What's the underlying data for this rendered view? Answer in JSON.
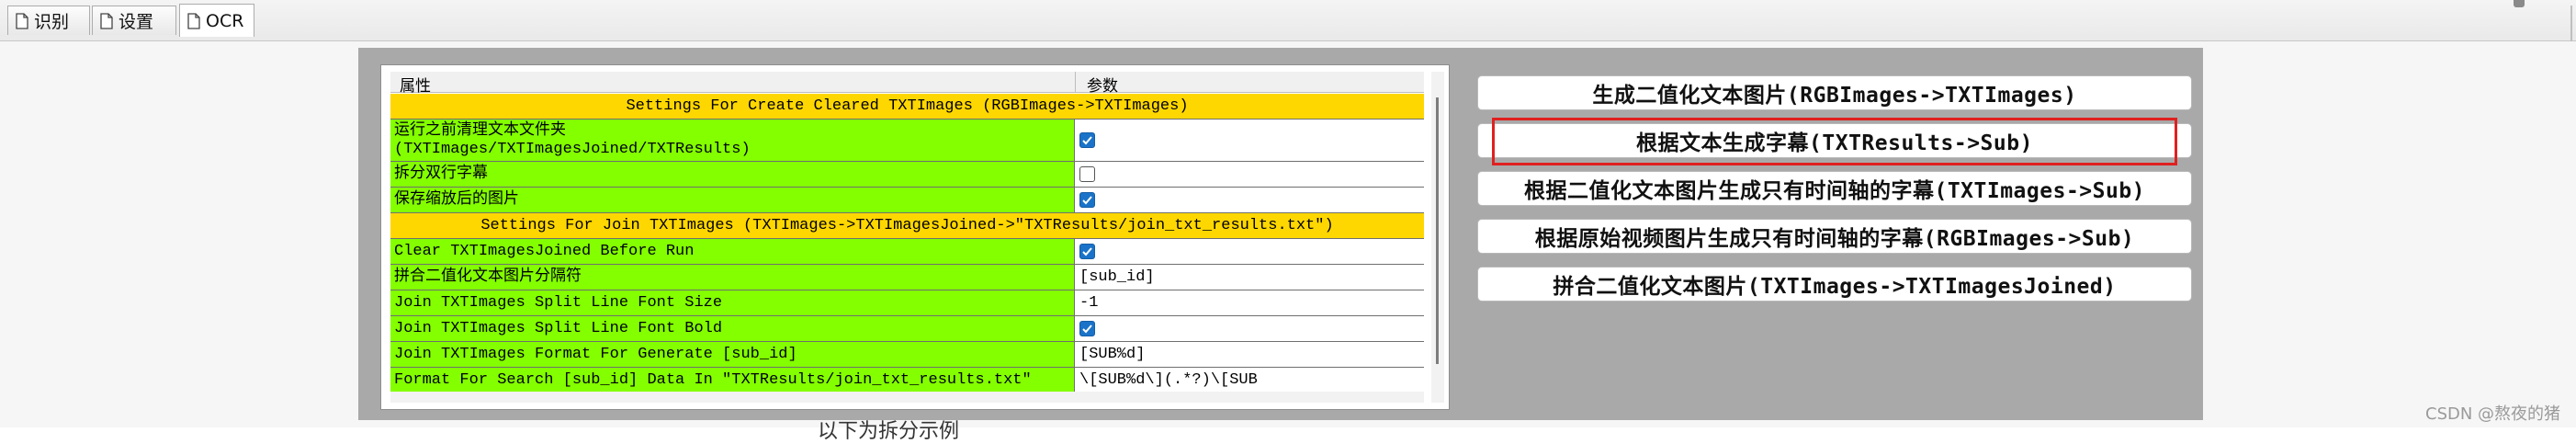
{
  "tabs": [
    {
      "label": "识别",
      "icon": "document-icon"
    },
    {
      "label": "设置",
      "icon": "document-icon"
    },
    {
      "label": "OCR",
      "icon": "document-icon"
    }
  ],
  "grid": {
    "headers": {
      "property": "属性",
      "value": "参数"
    },
    "sections": [
      {
        "title": "Settings For Create Cleared TXTImages (RGBImages->TXTImages)"
      },
      {
        "title": "Settings For Join TXTImages (TXTImages->TXTImagesJoined->\"TXTResults/join_txt_results.txt\")"
      }
    ],
    "rows": [
      {
        "name": "运行之前清理文本文件夹\n(TXTImages/TXTImagesJoined/TXTResults)",
        "checked": true
      },
      {
        "name": "拆分双行字幕",
        "checked": false
      },
      {
        "name": "保存缩放后的图片",
        "checked": true
      },
      {
        "name": "Clear TXTImagesJoined Before Run",
        "checked": true
      },
      {
        "name": "拼合二值化文本图片分隔符",
        "value": "[sub_id]"
      },
      {
        "name": "Join TXTImages Split Line Font Size",
        "value": "-1"
      },
      {
        "name": "Join TXTImages Split Line Font Bold",
        "checked": true
      },
      {
        "name": "Join TXTImages Format For Generate [sub_id]",
        "value": "[SUB%d]"
      },
      {
        "name": "Format For Search [sub_id] Data In \"TXTResults/join_txt_results.txt\"",
        "value": "\\[SUB%d\\](.*?)\\[SUB"
      }
    ]
  },
  "actions": [
    {
      "label": "生成二值化文本图片(RGBImages->TXTImages)"
    },
    {
      "label": "根据文本生成字幕(TXTResults->Sub)",
      "highlighted": true
    },
    {
      "label": "根据二值化文本图片生成只有时间轴的字幕(TXTImages->Sub)"
    },
    {
      "label": "根据原始视频图片生成只有时间轴的字幕(RGBImages->Sub)"
    },
    {
      "label": "拼合二值化文本图片(TXTImages->TXTImagesJoined)"
    }
  ],
  "under_text": "以下为拆分示例",
  "watermark": "CSDN @熬夜的猪",
  "colors": {
    "section_bg": "#ffd700",
    "property_bg": "#84ff00",
    "panel_bg": "#a9a9a9",
    "checkbox_on": "#1a73c8",
    "highlight_border": "#e02020"
  }
}
